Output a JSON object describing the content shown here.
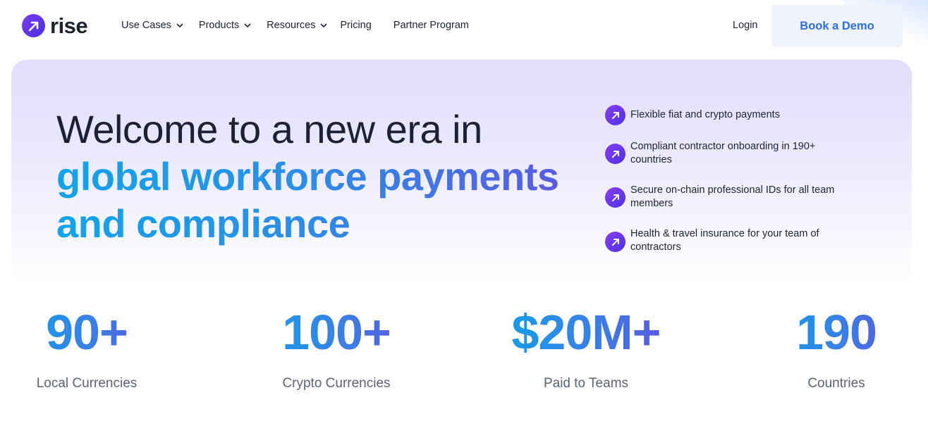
{
  "brand": {
    "name": "rise",
    "logo_icon": "arrow-up-right-circle"
  },
  "nav": {
    "items": [
      {
        "label": "Use Cases",
        "has_dropdown": true
      },
      {
        "label": "Products",
        "has_dropdown": true
      },
      {
        "label": "Resources",
        "has_dropdown": true
      },
      {
        "label": "Pricing",
        "has_dropdown": false
      },
      {
        "label": "Partner Program",
        "has_dropdown": false
      }
    ],
    "login_label": "Login",
    "cta_label": "Book a Demo"
  },
  "hero": {
    "headline_line1": "Welcome to a new era in",
    "headline_line2": "global workforce payments",
    "headline_line3": "and compliance",
    "features": [
      {
        "text": "Flexible fiat and crypto payments",
        "icon": "arrow-up-right-icon"
      },
      {
        "text": "Compliant contractor onboarding in 190+ countries",
        "icon": "arrow-up-right-icon"
      },
      {
        "text": "Secure on-chain professional IDs for all team members",
        "icon": "arrow-up-right-icon"
      },
      {
        "text": "Health & travel insurance for your team of contractors",
        "icon": "arrow-up-right-icon"
      }
    ]
  },
  "stats": [
    {
      "value": "90+",
      "label": "Local Currencies"
    },
    {
      "value": "100+",
      "label": "Crypto Currencies"
    },
    {
      "value": "$20M+",
      "label": "Paid to Teams"
    },
    {
      "value": "190",
      "label": "Countries"
    }
  ],
  "colors": {
    "brand_purple": "#6a37ec",
    "cta_text": "#2f6fe6",
    "cta_bg": "#eef3fd",
    "gradient_start": "#12a4ea",
    "gradient_end": "#6055e0"
  }
}
